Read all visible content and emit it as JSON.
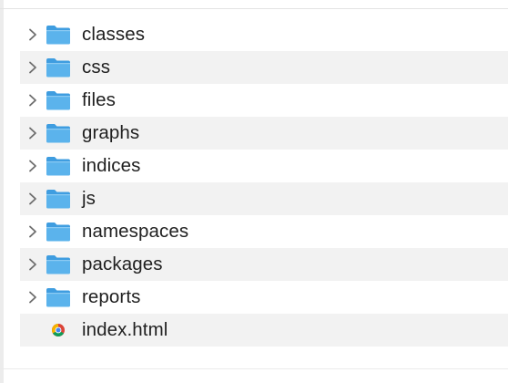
{
  "items": [
    {
      "name": "classes",
      "kind": "folder",
      "icon": "folder-icon"
    },
    {
      "name": "css",
      "kind": "folder",
      "icon": "folder-icon"
    },
    {
      "name": "files",
      "kind": "folder",
      "icon": "folder-icon"
    },
    {
      "name": "graphs",
      "kind": "folder",
      "icon": "folder-icon"
    },
    {
      "name": "indices",
      "kind": "folder",
      "icon": "folder-icon"
    },
    {
      "name": "js",
      "kind": "folder",
      "icon": "folder-icon"
    },
    {
      "name": "namespaces",
      "kind": "folder",
      "icon": "folder-icon"
    },
    {
      "name": "packages",
      "kind": "folder",
      "icon": "folder-icon"
    },
    {
      "name": "reports",
      "kind": "folder",
      "icon": "folder-icon"
    },
    {
      "name": "index.html",
      "kind": "file",
      "icon": "chrome-html-file-icon"
    }
  ],
  "colors": {
    "folder_body": "#5bb3ec",
    "folder_tab": "#3f9de0",
    "stripe": "#f2f2f2",
    "text": "#1f1f1f",
    "chevron": "#6e6e6e"
  }
}
